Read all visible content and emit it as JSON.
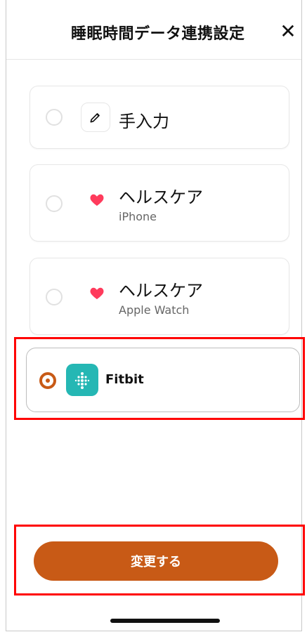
{
  "header": {
    "title": "睡眠時間データ連携設定",
    "close_glyph": "✕"
  },
  "options": [
    {
      "id": "manual",
      "label": "手入力",
      "sublabel": "",
      "selected": false,
      "icon": "pencil-icon"
    },
    {
      "id": "health-iphone",
      "label": "ヘルスケア",
      "sublabel": "iPhone",
      "selected": false,
      "icon": "heart-icon"
    },
    {
      "id": "health-watch",
      "label": "ヘルスケア",
      "sublabel": "Apple Watch",
      "selected": false,
      "icon": "heart-icon"
    },
    {
      "id": "fitbit",
      "label": "Fitbit",
      "sublabel": "",
      "selected": true,
      "icon": "fitbit-icon"
    }
  ],
  "cta": {
    "label": "変更する"
  },
  "colors": {
    "accent": "#c85a16",
    "fitbit": "#25b7b4",
    "heart": "#ff3b5c",
    "highlight": "#ff0000"
  }
}
